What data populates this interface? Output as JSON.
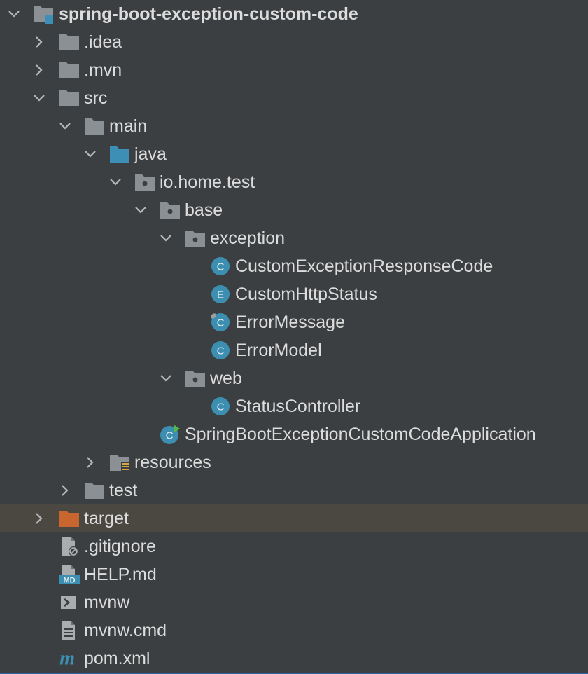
{
  "colors": {
    "background": "#3c3f41",
    "selected_row": "#4b4841",
    "folder": "#8b9094",
    "source_folder": "#3d8fb5",
    "class_badge": "#3c8fb0",
    "excluded_folder": "#c9652e",
    "text": "#dcdcdc"
  },
  "tree": {
    "items": [
      {
        "label": "spring-boot-exception-custom-code",
        "icon": "module-folder-icon",
        "expanded": true
      },
      {
        "label": ".idea",
        "icon": "folder-icon",
        "expanded": false
      },
      {
        "label": ".mvn",
        "icon": "folder-icon",
        "expanded": false
      },
      {
        "label": "src",
        "icon": "folder-icon",
        "expanded": true
      },
      {
        "label": "main",
        "icon": "folder-icon",
        "expanded": true
      },
      {
        "label": "java",
        "icon": "source-folder-icon",
        "expanded": true
      },
      {
        "label": "io.home.test",
        "icon": "package-icon",
        "expanded": true
      },
      {
        "label": "base",
        "icon": "package-icon",
        "expanded": true
      },
      {
        "label": "exception",
        "icon": "package-icon",
        "expanded": true
      },
      {
        "label": "CustomExceptionResponseCode",
        "icon": "class-icon",
        "badge": "C"
      },
      {
        "label": "CustomHttpStatus",
        "icon": "enum-icon",
        "badge": "E"
      },
      {
        "label": "ErrorMessage",
        "icon": "class-icon",
        "badge": "C"
      },
      {
        "label": "ErrorModel",
        "icon": "class-icon",
        "badge": "C"
      },
      {
        "label": "web",
        "icon": "package-icon",
        "expanded": true
      },
      {
        "label": "StatusController",
        "icon": "class-icon",
        "badge": "C"
      },
      {
        "label": "SpringBootExceptionCustomCodeApplication",
        "icon": "spring-boot-class-icon",
        "badge": "C"
      },
      {
        "label": "resources",
        "icon": "resources-folder-icon",
        "expanded": false
      },
      {
        "label": "test",
        "icon": "folder-icon",
        "expanded": false
      },
      {
        "label": "target",
        "icon": "excluded-folder-icon",
        "expanded": false,
        "selected": true
      },
      {
        "label": ".gitignore",
        "icon": "gitignore-file-icon"
      },
      {
        "label": "HELP.md",
        "icon": "markdown-file-icon",
        "badge": "MD"
      },
      {
        "label": "mvnw",
        "icon": "shell-script-icon"
      },
      {
        "label": "mvnw.cmd",
        "icon": "text-file-icon"
      },
      {
        "label": "pom.xml",
        "icon": "maven-icon",
        "badge": "m"
      }
    ]
  }
}
